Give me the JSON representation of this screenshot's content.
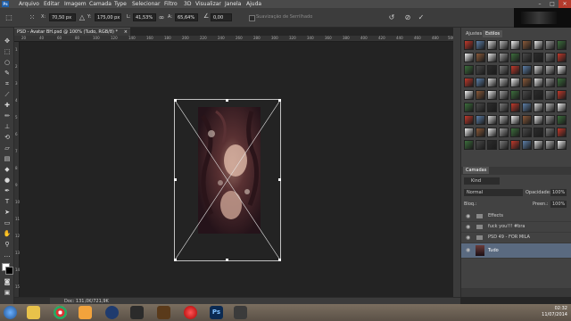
{
  "menu": {
    "logo": "Ps",
    "items": [
      "Arquivo",
      "Editar",
      "Imagem",
      "Camada",
      "Type",
      "Selecionar",
      "Filtro",
      "3D",
      "Visualizar",
      "Janela",
      "Ajuda"
    ],
    "minimize": "–",
    "maximize": "□",
    "close": "✕"
  },
  "options": {
    "x_label": "X:",
    "x_value": "70,50 px",
    "y_label": "Y:",
    "y_value": "175,00 px",
    "w_label": "L:",
    "w_value": "41,53%",
    "h_label": "A:",
    "h_value": "65,64%",
    "angle_label": "∠",
    "angle_value": "0,00",
    "antialias_label": "Suavização de Serrilhado",
    "reset_icon": "↺",
    "cancel_icon": "⊘",
    "commit_icon": "✓"
  },
  "document": {
    "tab_title": "PSD - Avatar BH.psd @ 100% (Tudo, RGB/8) *",
    "close": "×",
    "status": "Doc: 131,0K/721,9K"
  },
  "rulers": {
    "top": [
      "20",
      "40",
      "60",
      "80",
      "100",
      "120",
      "140",
      "160",
      "180",
      "200",
      "220",
      "240",
      "260",
      "280",
      "300",
      "320",
      "340",
      "360",
      "380",
      "400",
      "420",
      "440",
      "460",
      "480",
      "500"
    ],
    "left": [
      "1",
      "2",
      "3",
      "4",
      "5",
      "6",
      "7",
      "8",
      "9",
      "10",
      "11",
      "12",
      "13",
      "14",
      "15"
    ]
  },
  "panels": {
    "tab_adjustments": "Ajustes",
    "tab_styles": "Estilos",
    "layers_tab": "Camadas",
    "filter_kind": "Kind",
    "blend_mode": "Normal",
    "opacity_label": "Opacidade:",
    "opacity_value": "100%",
    "lock_label": "Bloq.:",
    "fill_label": "Preen.:",
    "fill_value": "100%",
    "layers": [
      {
        "name": "Effects",
        "type": "folder"
      },
      {
        "name": "fuck you!!! #bra",
        "type": "folder"
      },
      {
        "name": "PSD 49 - FOR MILA",
        "type": "folder"
      },
      {
        "name": "Tudo",
        "type": "image"
      }
    ]
  },
  "taskbar": {
    "time": "02:32",
    "date": "11/07/2014"
  },
  "icons": [
    "menu-icon",
    "move-icon",
    "marquee-icon",
    "lasso-icon",
    "quick-select-icon",
    "crop-icon",
    "eyedropper-icon",
    "healing-icon",
    "brush-icon",
    "stamp-icon",
    "history-brush-icon",
    "eraser-icon",
    "gradient-icon",
    "blur-icon",
    "dodge-icon",
    "pen-icon",
    "type-icon",
    "path-select-icon",
    "shape-icon",
    "hand-icon",
    "zoom-icon"
  ],
  "colors": {
    "accent": "#5a6a80",
    "canvas_bg": "#232323",
    "panel_bg": "#424242"
  }
}
